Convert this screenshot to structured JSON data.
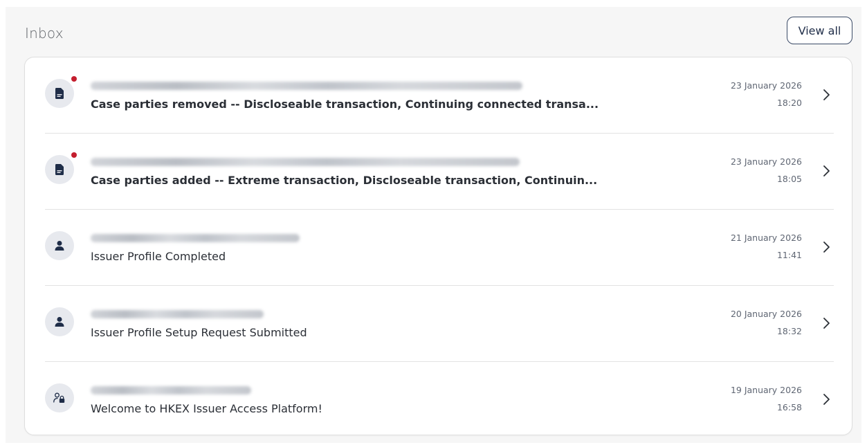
{
  "inbox": {
    "title": "Inbox",
    "view_all_label": "View all"
  },
  "messages": [
    {
      "icon": "document-icon",
      "unread": true,
      "subject": "Case parties removed -- Discloseable transaction, Continuing connected transa...",
      "date": "23 January 2026",
      "time": "18:20"
    },
    {
      "icon": "document-icon",
      "unread": true,
      "subject": "Case parties added -- Extreme transaction, Discloseable transaction, Continuin...",
      "date": "23 January 2026",
      "time": "18:05"
    },
    {
      "icon": "person-icon",
      "unread": false,
      "subject": "Issuer Profile Completed",
      "date": "21 January 2026",
      "time": "11:41"
    },
    {
      "icon": "person-icon",
      "unread": false,
      "subject": "Issuer Profile Setup Request Submitted",
      "date": "20 January 2026",
      "time": "18:32"
    },
    {
      "icon": "user-lock-icon",
      "unread": false,
      "subject": "Welcome to HKEX Issuer Access Platform!",
      "date": "19 January 2026",
      "time": "16:58"
    }
  ],
  "colors": {
    "unread_dot": "#c41e2e",
    "icon_fill": "#1f2d48",
    "avatar_bg": "#e7e9ee"
  }
}
